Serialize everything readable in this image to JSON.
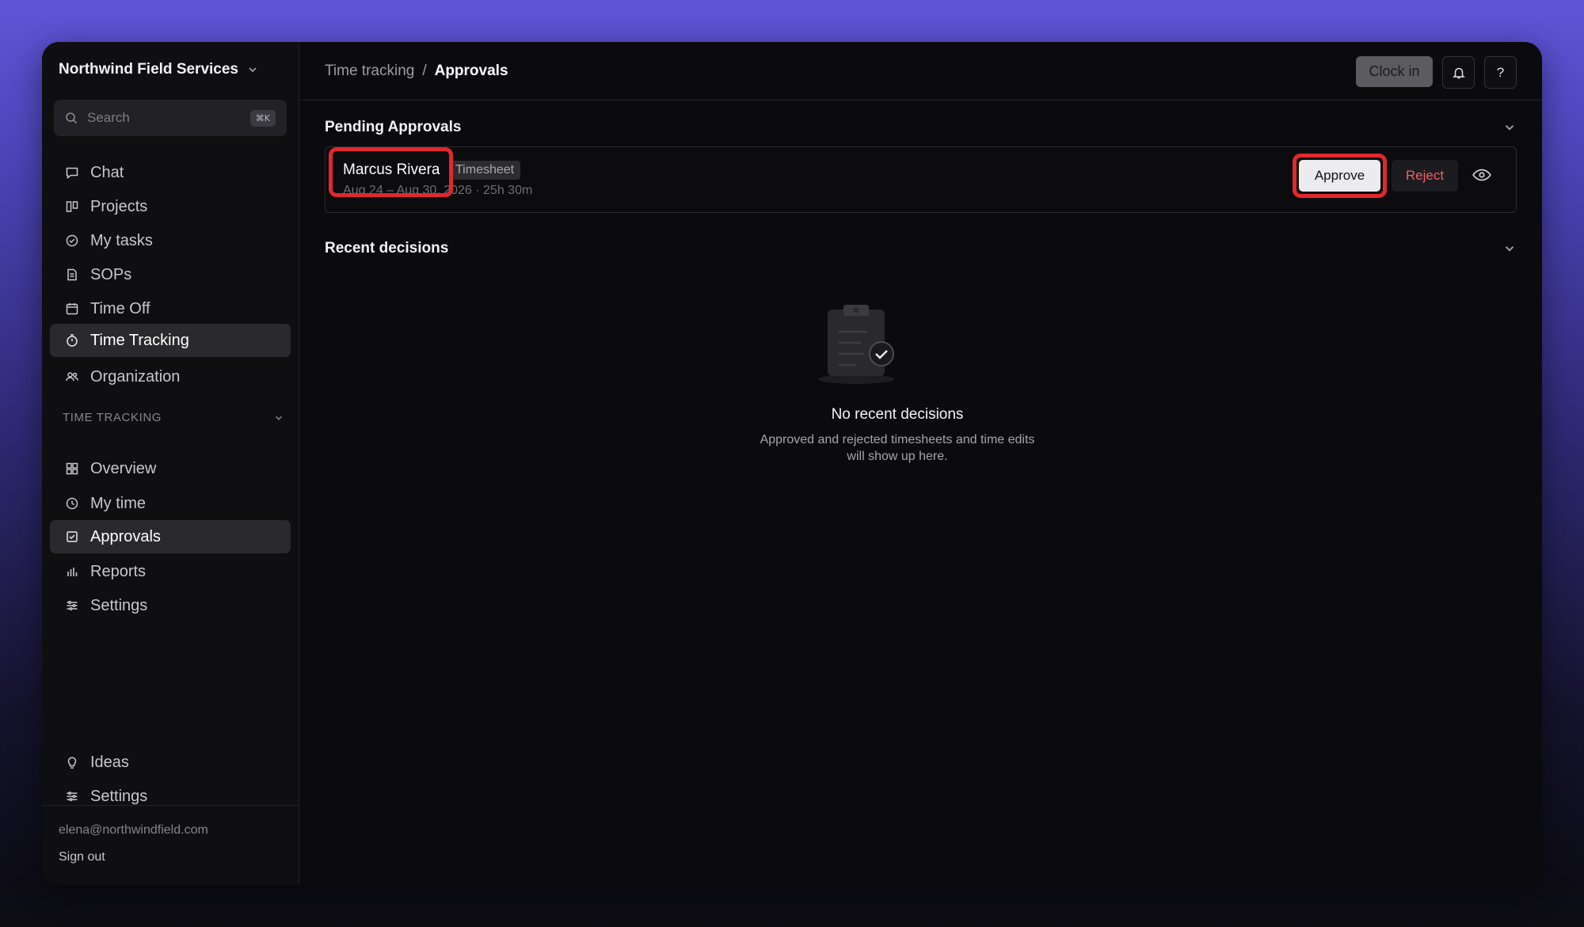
{
  "workspace": {
    "name": "Northwind Field Services"
  },
  "search": {
    "placeholder": "Search",
    "shortcut": "⌘K"
  },
  "nav": {
    "items": [
      {
        "label": "Chat",
        "icon": "chat-icon"
      },
      {
        "label": "Projects",
        "icon": "projects-icon"
      },
      {
        "label": "My tasks",
        "icon": "check-circle-icon"
      },
      {
        "label": "SOPs",
        "icon": "document-icon"
      },
      {
        "label": "Time Off",
        "icon": "calendar-icon"
      },
      {
        "label": "Time Tracking",
        "icon": "stopwatch-icon",
        "active": true
      },
      {
        "label": "Organization",
        "icon": "users-icon"
      }
    ],
    "section_label": "TIME TRACKING",
    "sub_items": [
      {
        "label": "Overview",
        "icon": "grid-icon"
      },
      {
        "label": "My time",
        "icon": "clock-icon"
      },
      {
        "label": "Approvals",
        "icon": "checkbox-icon",
        "active": true
      },
      {
        "label": "Reports",
        "icon": "bar-chart-icon"
      },
      {
        "label": "Settings",
        "icon": "sliders-icon"
      }
    ],
    "bottom_items": [
      {
        "label": "Ideas",
        "icon": "lightbulb-icon"
      },
      {
        "label": "Settings",
        "icon": "sliders-icon"
      }
    ]
  },
  "user": {
    "email": "elena@northwindfield.com",
    "signout_label": "Sign out"
  },
  "breadcrumb": {
    "parent": "Time tracking",
    "separator": "/",
    "current": "Approvals"
  },
  "header": {
    "clock_in_label": "Clock in",
    "help_label": "?"
  },
  "pending": {
    "title": "Pending Approvals",
    "items": [
      {
        "name": "Marcus Rivera",
        "type": "Timesheet",
        "meta": "Aug 24 – Aug 30, 2026 · 25h 30m",
        "approve_label": "Approve",
        "reject_label": "Reject"
      }
    ]
  },
  "recent": {
    "title": "Recent decisions",
    "empty_title": "No recent decisions",
    "empty_desc": "Approved and rejected timesheets and time edits will show up here."
  },
  "colors": {
    "highlight": "#e0282e",
    "reject": "#ee5f63",
    "accent_bg": "#5f55d8"
  }
}
